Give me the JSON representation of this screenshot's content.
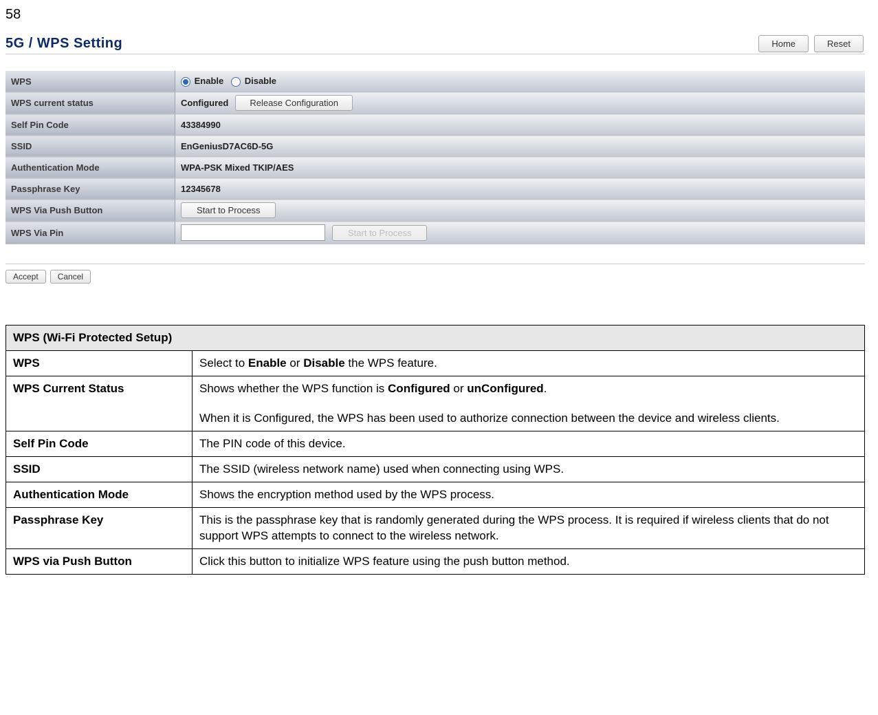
{
  "page_number": "58",
  "screenshot": {
    "title": "5G / WPS Setting",
    "buttons": {
      "home": "Home",
      "reset": "Reset"
    },
    "rows": {
      "wps_label": "WPS",
      "wps_enable": "Enable",
      "wps_disable": "Disable",
      "status_label": "WPS current status",
      "status_value": "Configured",
      "release_btn": "Release Configuration",
      "selfpin_label": "Self Pin Code",
      "selfpin_value": "43384990",
      "ssid_label": "SSID",
      "ssid_value": "EnGeniusD7AC6D-5G",
      "auth_label": "Authentication Mode",
      "auth_value": "WPA-PSK Mixed TKIP/AES",
      "pass_label": "Passphrase Key",
      "pass_value": "12345678",
      "push_label": "WPS Via Push Button",
      "push_btn": "Start to Process",
      "pin_label": "WPS Via Pin",
      "pin_btn": "Start to Process"
    },
    "actions": {
      "accept": "Accept",
      "cancel": "Cancel"
    }
  },
  "desc": {
    "header": "WPS (Wi-Fi Protected Setup)",
    "wps_label": "WPS",
    "wps_text_a": "Select to ",
    "wps_text_b": "Enable",
    "wps_text_c": " or ",
    "wps_text_d": "Disable",
    "wps_text_e": " the WPS feature.",
    "status_label": "WPS Current Status",
    "status_text_a": "Shows whether the WPS function is ",
    "status_text_b": "Configured",
    "status_text_c": " or ",
    "status_text_d": "unConfigured",
    "status_text_e": ".",
    "status_text_f": "When it is Configured, the WPS has been used to authorize connection between the device and wireless clients.",
    "selfpin_label": "Self Pin Code",
    "selfpin_text": "The PIN code of this device.",
    "ssid_label": "SSID",
    "ssid_text": "The SSID (wireless network name) used when connecting using WPS.",
    "auth_label": "Authentication Mode",
    "auth_text": "Shows the encryption method used by the WPS process.",
    "pass_label": "Passphrase Key",
    "pass_text": "This is the passphrase key that is randomly generated during the WPS process. It is required if wireless clients that do not support WPS attempts to connect to the wireless network.",
    "push_label": "WPS via Push Button",
    "push_text": "Click this button to initialize WPS feature using the push button method."
  }
}
